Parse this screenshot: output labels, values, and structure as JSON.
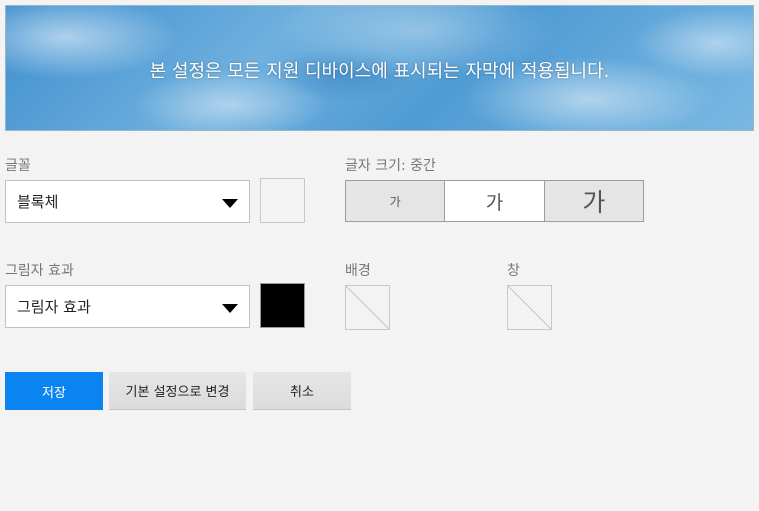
{
  "preview": {
    "caption": "본 설정은 모든 지원 디바이스에 표시되는 자막에 적용됩니다."
  },
  "font": {
    "label": "글꼴",
    "selected": "블록체",
    "color_swatch": "#f3f3f3"
  },
  "font_size": {
    "label": "글자 크기: 중간",
    "options": [
      {
        "glyph": "가",
        "name": "small"
      },
      {
        "glyph": "가",
        "name": "medium",
        "selected": true
      },
      {
        "glyph": "가",
        "name": "large"
      }
    ]
  },
  "shadow": {
    "label": "그림자 효과",
    "selected": "그림자 효과",
    "color_swatch": "#000000"
  },
  "background": {
    "label": "배경",
    "value": "none"
  },
  "window": {
    "label": "창",
    "value": "none"
  },
  "buttons": {
    "save": "저장",
    "reset": "기본 설정으로 변경",
    "cancel": "취소"
  },
  "colors": {
    "primary": "#0a84f0",
    "page_bg": "#f3f3f3"
  }
}
